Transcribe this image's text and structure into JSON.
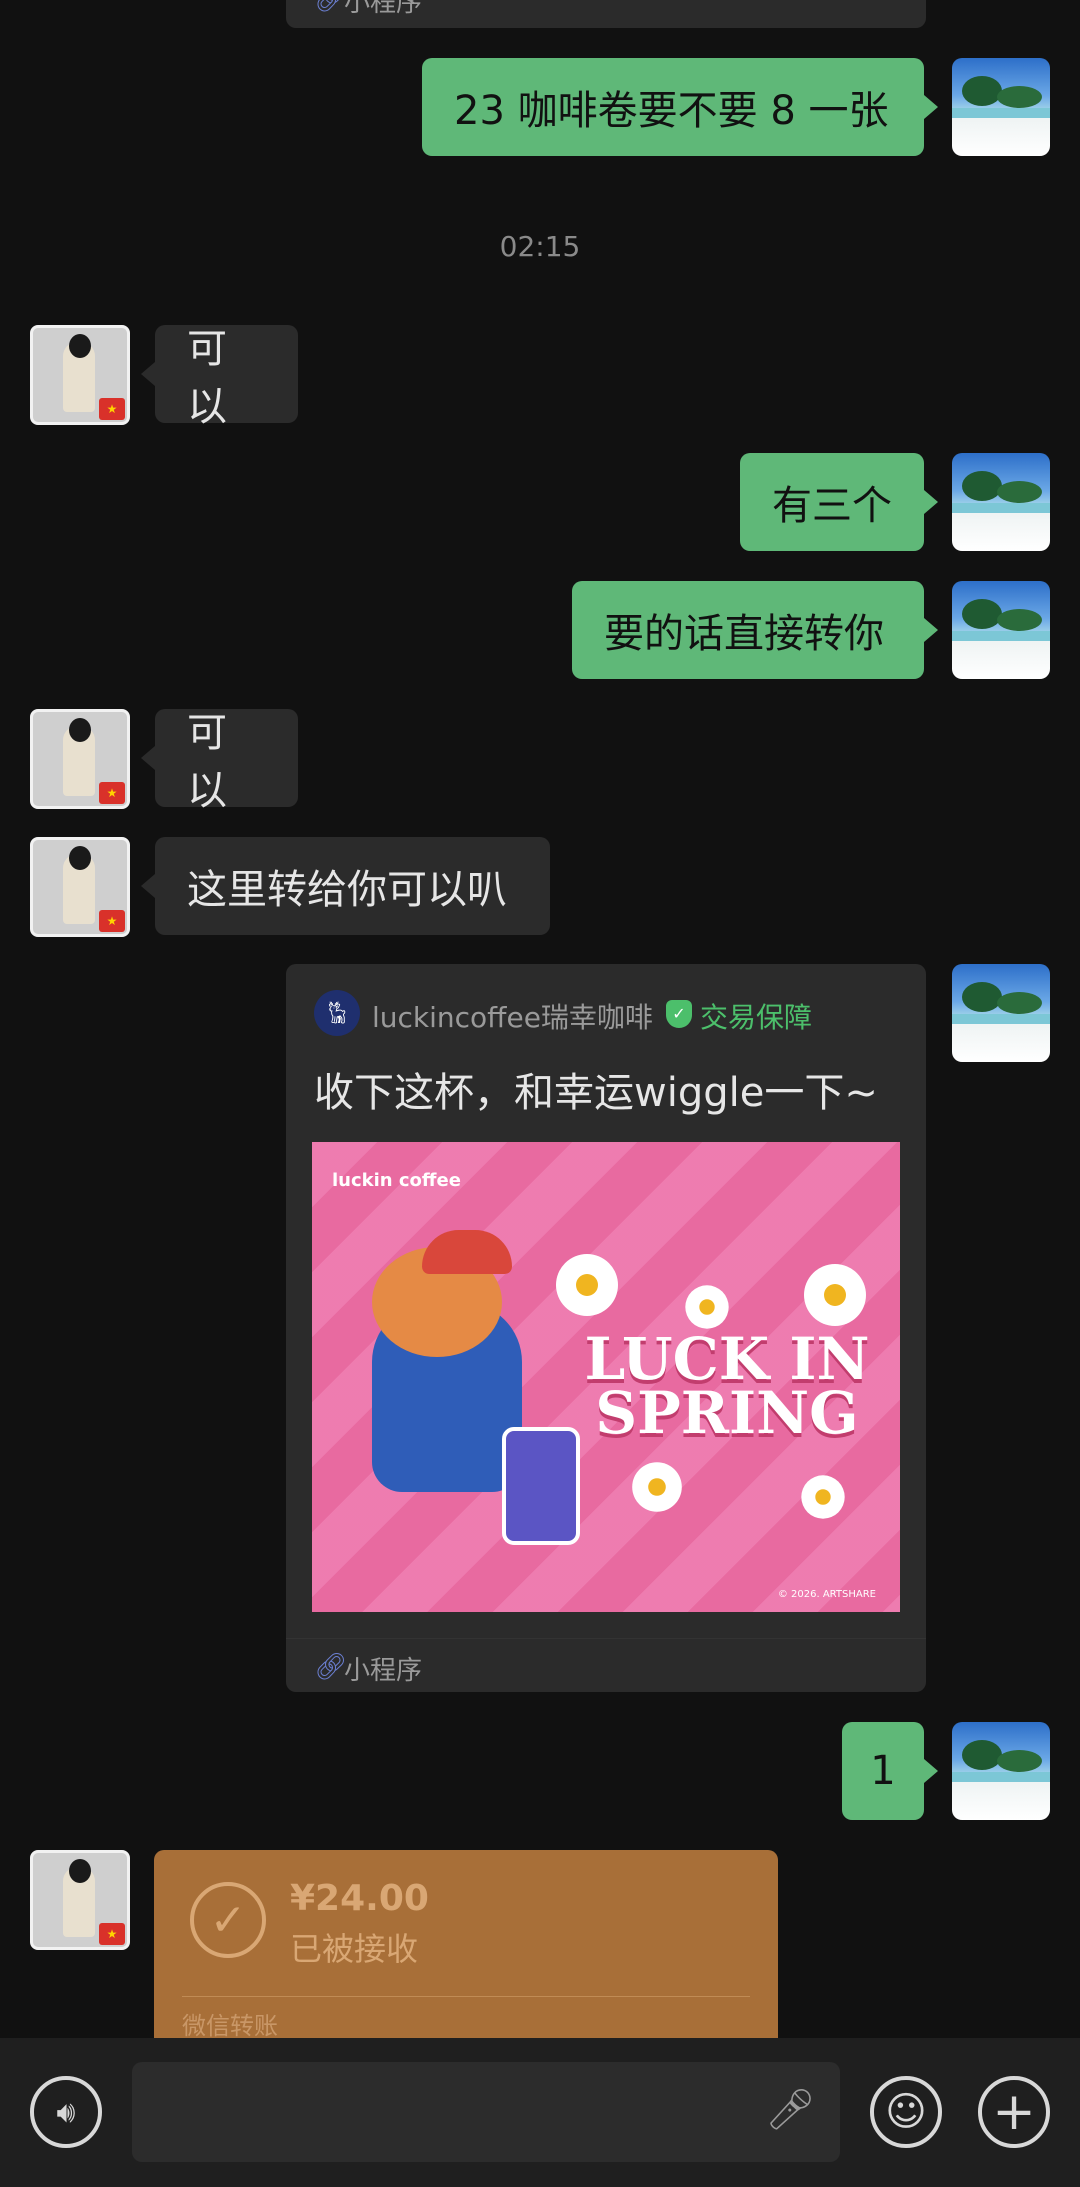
{
  "top_card": {
    "mp_label": "小程序"
  },
  "messages": [
    {
      "from": "me",
      "text": "23 咖啡卷要不要  8 一张"
    },
    {
      "from": "them",
      "text": "可以"
    },
    {
      "from": "me",
      "text": "有三个"
    },
    {
      "from": "me",
      "text": "要的话直接转你"
    },
    {
      "from": "them",
      "text": "可以"
    },
    {
      "from": "them",
      "text": "这里转给你可以叭"
    },
    {
      "from": "me",
      "text": "1"
    }
  ],
  "timestamp": "02:15",
  "mini_program_card": {
    "brand": "luckincoffee瑞幸咖啡",
    "guarantee": "交易保障",
    "title": "收下这杯，和幸运wiggle一下~",
    "banner_top": "luckin coffee",
    "banner_headline_1": "LUCK IN",
    "banner_headline_2": "SPRING",
    "banner_copyright": "© 2026. ARTSHARE",
    "mp_label": "小程序"
  },
  "transfer": {
    "amount": "¥24.00",
    "status": "已被接收",
    "label": "微信转账"
  },
  "colors": {
    "background": "#111111",
    "my_bubble": "#5fb878",
    "their_bubble": "#2b2b2b",
    "transfer_card": "#a86f38",
    "guarantee_green": "#4cbf6b"
  },
  "icons": {
    "voice": "voice-icon",
    "emoji": "emoji-icon",
    "plus": "plus-icon",
    "mic": "mic-icon",
    "mini_program": "mini-program-icon"
  }
}
